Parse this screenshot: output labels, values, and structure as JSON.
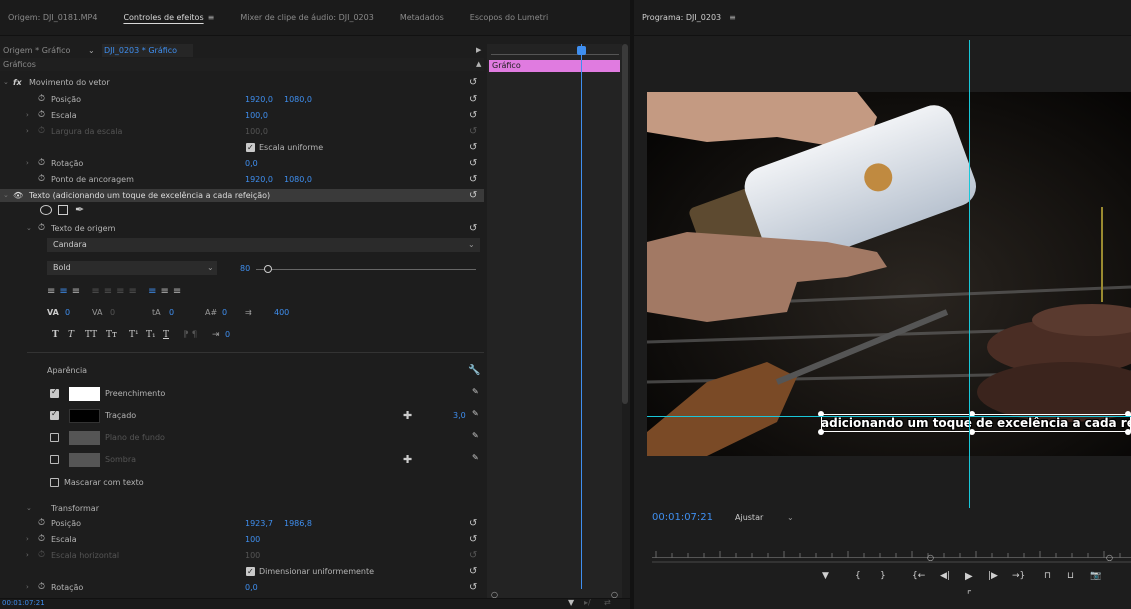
{
  "left_tabs": [
    "Origem: DJI_0181.MP4",
    "Controles de efeitos",
    "Mixer de clipe de áudio: DJI_0203",
    "Metadados",
    "Escopos do Lumetri"
  ],
  "menu_glyph": "≡",
  "breadcrumb": {
    "source": "Origem * Gráfico",
    "clip": "DJI_0203 * Gráfico"
  },
  "section": "Gráficos",
  "timeline_clip": "Gráfico",
  "vector_motion": {
    "title": "Movimento do vetor",
    "position": {
      "label": "Posição",
      "x": "1920,0",
      "y": "1080,0"
    },
    "scale": {
      "label": "Escala",
      "value": "100,0"
    },
    "scale_width": {
      "label": "Largura da escala",
      "value": "100,0"
    },
    "uniform": "Escala uniforme",
    "rotation": {
      "label": "Rotação",
      "value": "0,0"
    },
    "anchor": {
      "label": "Ponto de ancoragem",
      "x": "1920,0",
      "y": "1080,0"
    }
  },
  "text_layer": {
    "title": "Texto (adicionando um toque de excelência a cada refeição)",
    "source_text": "Texto de origem",
    "font": "Candara",
    "style": "Bold",
    "size": "80",
    "tracking": {
      "kerning": "0",
      "tracking": "0",
      "baseline": "0",
      "tsume": "0",
      "leading": "400",
      "indent": "0"
    },
    "typo_buttons": [
      "T",
      "T",
      "TT",
      "Tт",
      "T¹",
      "T₁",
      "T"
    ],
    "appearance": "Aparência",
    "fill": "Preenchimento",
    "stroke": "Traçado",
    "stroke_width": "3,0",
    "background": "Plano de fundo",
    "shadow": "Sombra",
    "mask": "Mascarar com texto",
    "fill_color": "#ffffff",
    "stroke_color": "#000000"
  },
  "transform": {
    "title": "Transformar",
    "position": {
      "label": "Posição",
      "x": "1923,7",
      "y": "1986,8"
    },
    "scale": {
      "label": "Escala",
      "value": "100"
    },
    "scale_h": {
      "label": "Escala horizontal",
      "value": "100"
    },
    "uniform": "Dimensionar uniformemente",
    "rotation": {
      "label": "Rotação",
      "value": "0,0"
    }
  },
  "left_timecode": "00:01:07:21",
  "program": {
    "title": "Programa: DJI_0203",
    "caption": "adicionando um toque de excelência a cada refeição",
    "timecode": "00:01:07:21",
    "fit": "Ajustar"
  },
  "colors": {
    "accent": "#3f8ff0",
    "clip": "#e07be0",
    "guide": "#19c6d8"
  }
}
